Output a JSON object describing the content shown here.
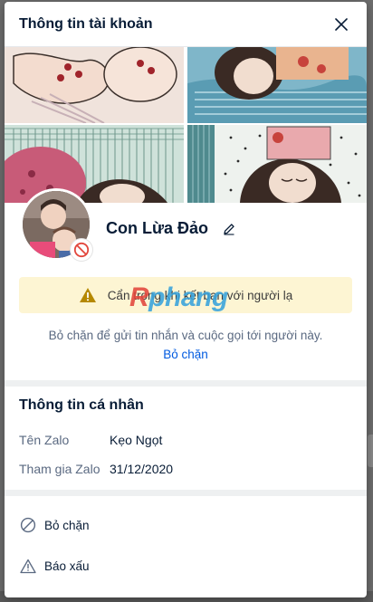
{
  "modal": {
    "title": "Thông tin tài khoản"
  },
  "profile": {
    "display_name": "Con Lừa Đảo",
    "warning_text": "Cẩn trọng khi kết bạn với người lạ",
    "unblock_hint": "Bỏ chặn để gửi tin nhắn và cuộc gọi tới người này.",
    "unblock_link": "Bỏ chặn"
  },
  "watermark": {
    "part_a": "R",
    "part_b": "phang"
  },
  "personal_info": {
    "title": "Thông tin cá nhân",
    "rows": [
      {
        "label": "Tên Zalo",
        "value": "Kẹo Ngọt"
      },
      {
        "label": "Tham gia Zalo",
        "value": "31/12/2020"
      }
    ]
  },
  "actions": [
    {
      "label": "Bỏ chặn",
      "icon": "block-icon"
    },
    {
      "label": "Báo xấu",
      "icon": "warning-triangle-icon"
    }
  ],
  "colors": {
    "accent": "#005ae0",
    "warning_bg": "#fdf5d3",
    "block_red": "#e2463c",
    "text_primary": "#081c36",
    "text_secondary": "#5a6981"
  }
}
